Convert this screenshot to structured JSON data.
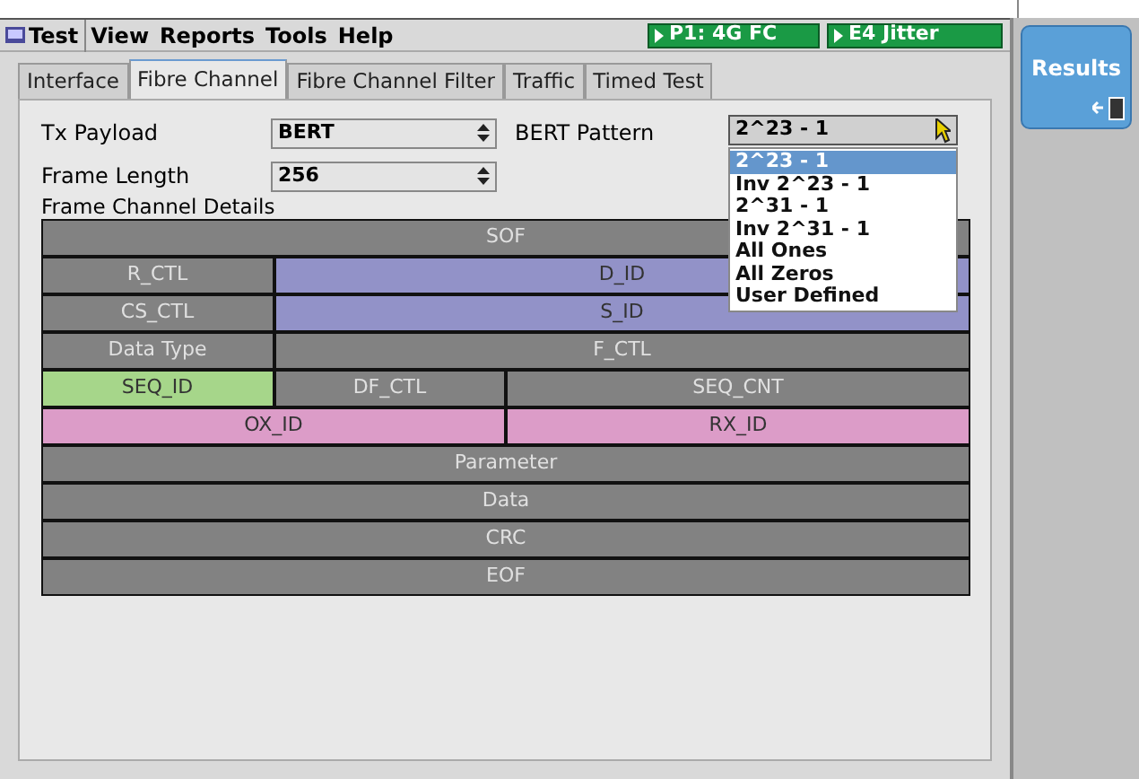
{
  "menu": [
    {
      "label": "Test",
      "selected": true
    },
    {
      "label": "View",
      "selected": false
    },
    {
      "label": "Reports",
      "selected": false
    },
    {
      "label": "Tools",
      "selected": false
    },
    {
      "label": "Help",
      "selected": false
    }
  ],
  "status": [
    {
      "label": "P1: 4G FC"
    },
    {
      "label": "E4 Jitter"
    }
  ],
  "tabs": [
    {
      "label": "Interface",
      "selected": false
    },
    {
      "label": "Fibre Channel",
      "selected": true
    },
    {
      "label": "Fibre Channel Filter",
      "selected": false
    },
    {
      "label": "Traffic",
      "selected": false
    },
    {
      "label": "Timed Test",
      "selected": false
    }
  ],
  "fields": [
    {
      "label": "Tx Payload",
      "value": "BERT"
    },
    {
      "label": "Frame Length",
      "value": "256"
    }
  ],
  "bert_pattern": {
    "label": "BERT Pattern",
    "value": "2^23 - 1",
    "expanded": true,
    "options": [
      {
        "label": "2^23 - 1",
        "selected": true
      },
      {
        "label": "Inv 2^23 - 1",
        "selected": false
      },
      {
        "label": "2^31 - 1",
        "selected": false
      },
      {
        "label": "Inv 2^31 - 1",
        "selected": false
      },
      {
        "label": "All Ones",
        "selected": false
      },
      {
        "label": "All Zeros",
        "selected": false
      },
      {
        "label": "User Defined",
        "selected": false
      }
    ]
  },
  "details_title": "Frame Channel Details",
  "frame_rows": [
    {
      "kind": "full",
      "cells": [
        {
          "label": "SOF",
          "color": "#828282"
        }
      ]
    },
    {
      "kind": "one_three",
      "cells": [
        {
          "label": "R_CTL",
          "color": "#828282"
        },
        {
          "label": "D_ID",
          "color": "#9292c8"
        }
      ]
    },
    {
      "kind": "one_three",
      "cells": [
        {
          "label": "CS_CTL",
          "color": "#828282"
        },
        {
          "label": "S_ID",
          "color": "#9292c8"
        }
      ]
    },
    {
      "kind": "one_three",
      "cells": [
        {
          "label": "Data Type",
          "color": "#828282"
        },
        {
          "label": "F_CTL",
          "color": "#828282"
        }
      ]
    },
    {
      "kind": "one_one_two",
      "cells": [
        {
          "label": "SEQ_ID",
          "color": "#a6d68a"
        },
        {
          "label": "DF_CTL",
          "color": "#828282"
        },
        {
          "label": "SEQ_CNT",
          "color": "#828282"
        }
      ]
    },
    {
      "kind": "halves",
      "cells": [
        {
          "label": "OX_ID",
          "color": "#dc9cc8"
        },
        {
          "label": "RX_ID",
          "color": "#dc9cc8"
        }
      ]
    },
    {
      "kind": "full",
      "cells": [
        {
          "label": "Parameter",
          "color": "#828282"
        }
      ]
    },
    {
      "kind": "full",
      "cells": [
        {
          "label": "Data",
          "color": "#828282"
        }
      ]
    },
    {
      "kind": "full",
      "cells": [
        {
          "label": "CRC",
          "color": "#828282"
        }
      ]
    },
    {
      "kind": "full",
      "cells": [
        {
          "label": "EOF",
          "color": "#828282"
        }
      ]
    }
  ],
  "results_button": {
    "label": "Results"
  }
}
